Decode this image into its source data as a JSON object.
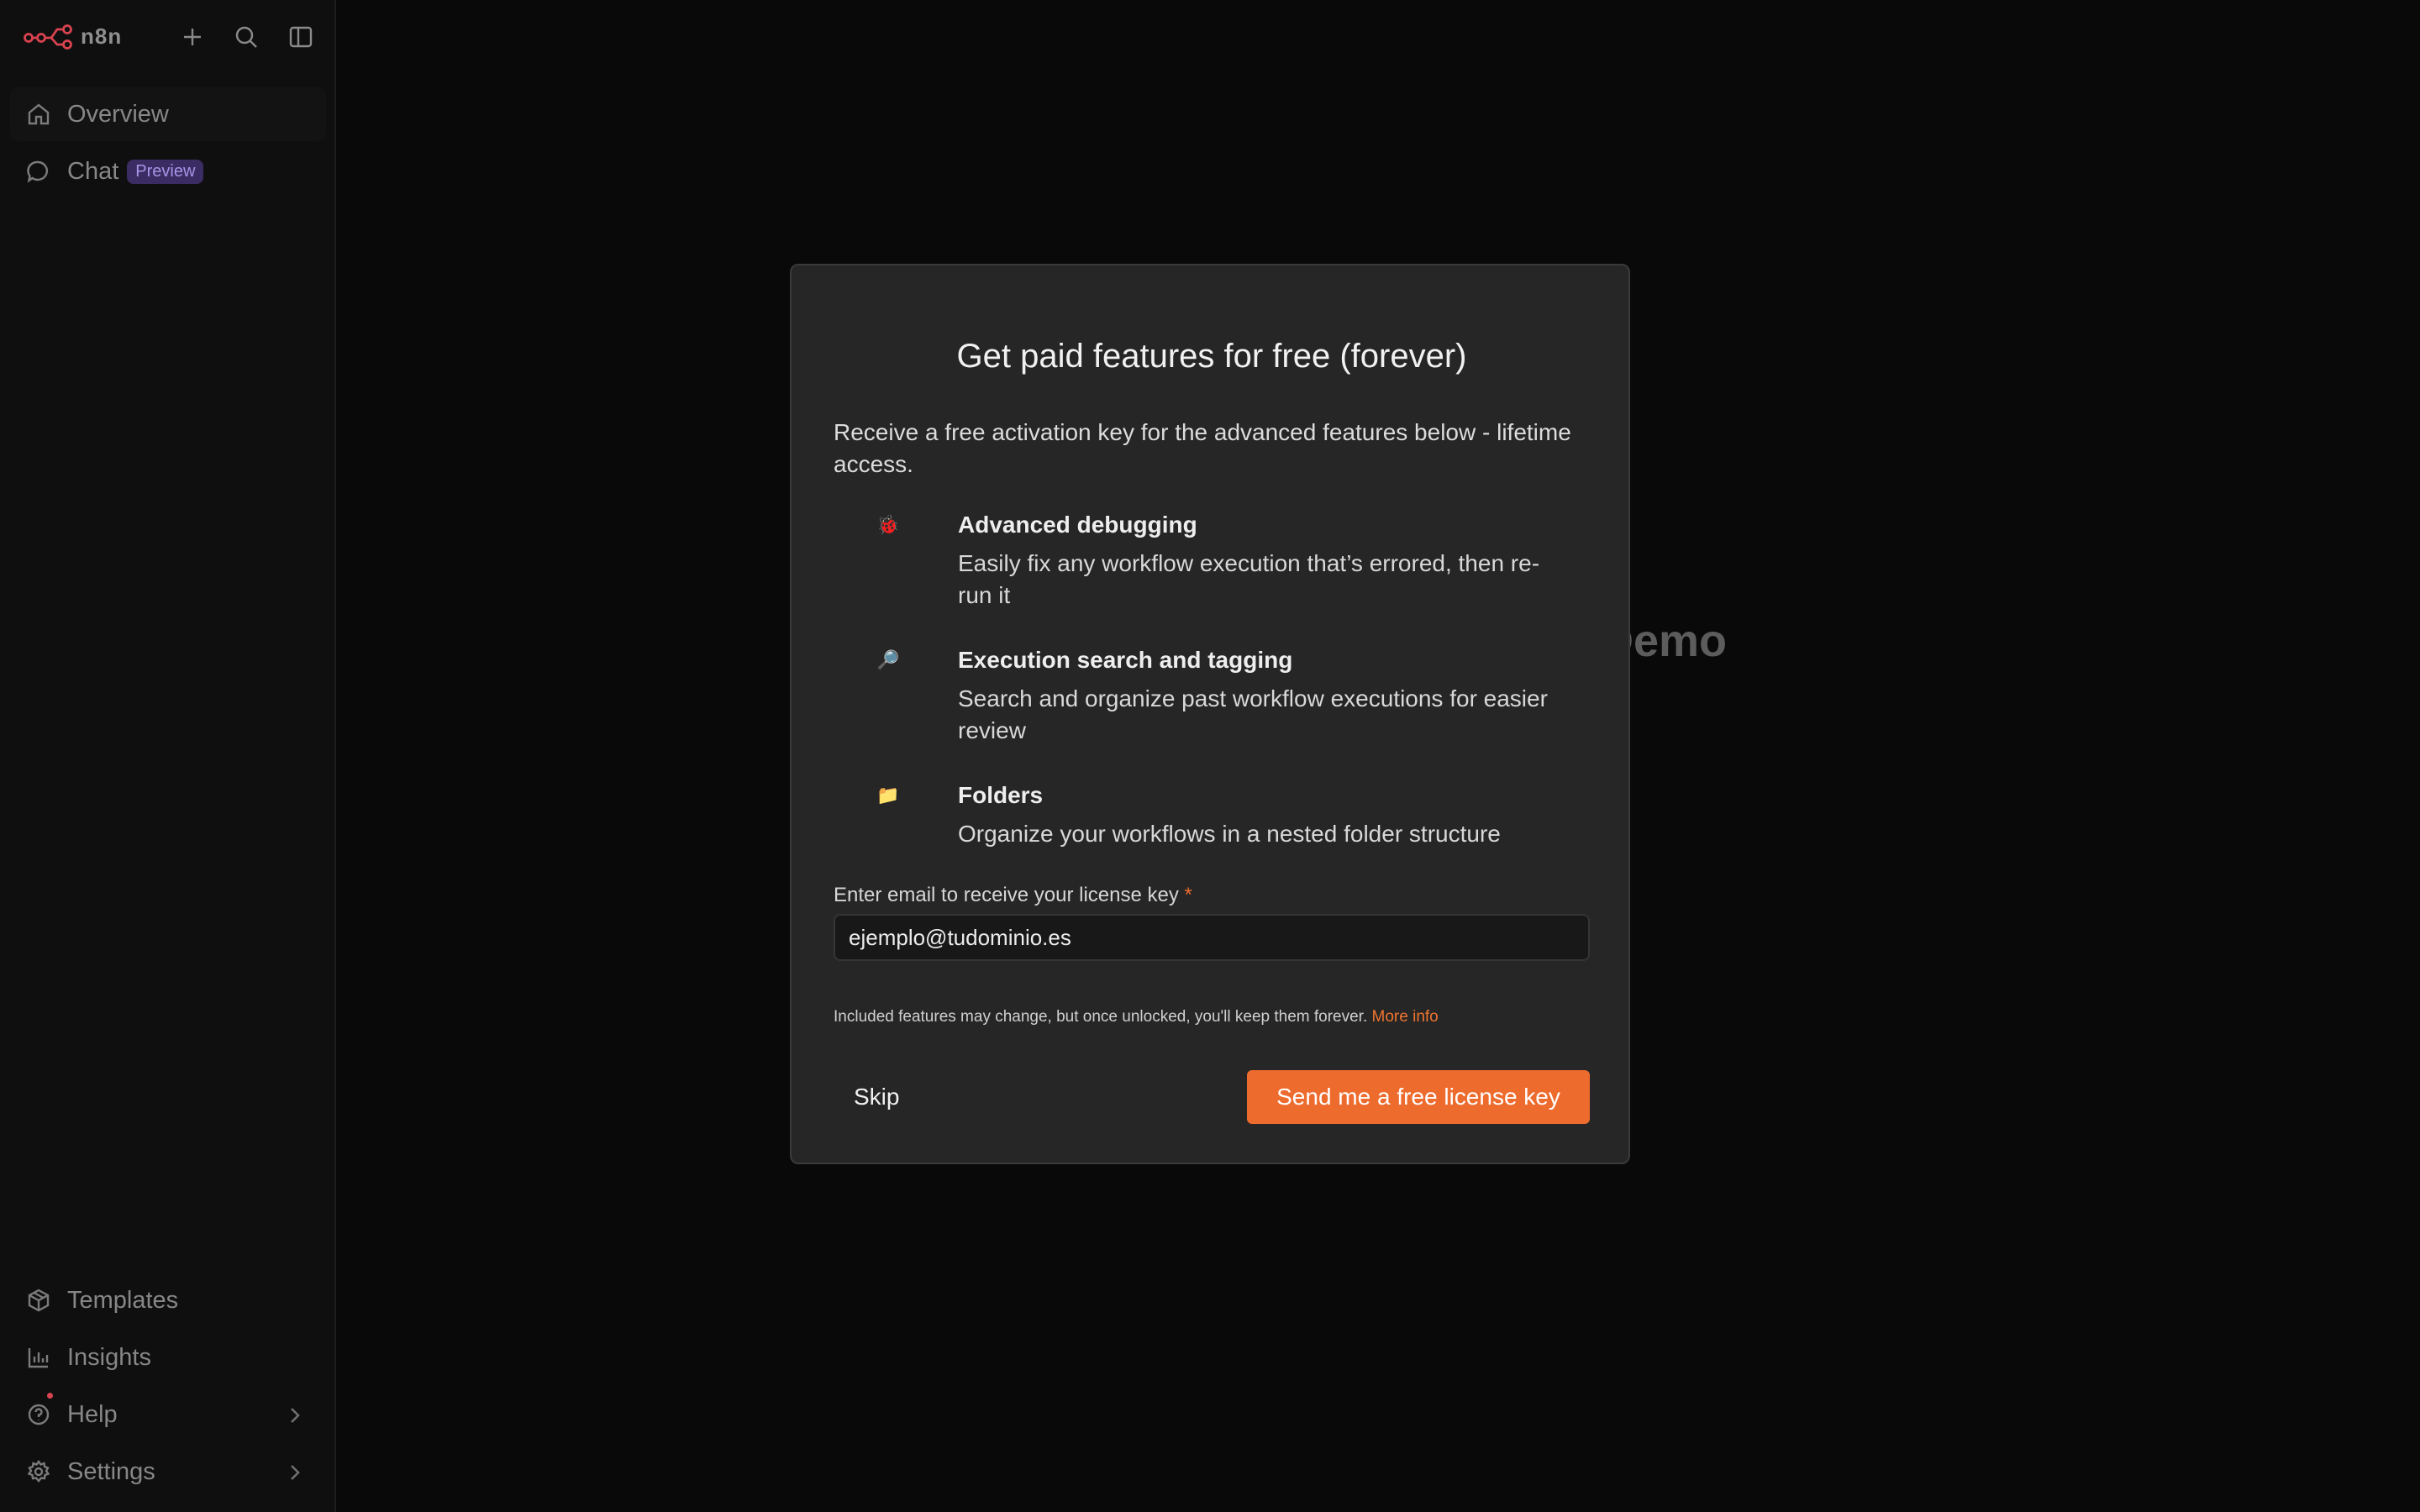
{
  "sidebar": {
    "logo_text": "n8n",
    "nav_top": [
      {
        "label": "Overview",
        "icon": "home-icon"
      },
      {
        "label": "Chat",
        "icon": "chat-icon",
        "badge": "Preview"
      }
    ],
    "nav_bottom": [
      {
        "label": "Templates",
        "icon": "templates-icon"
      },
      {
        "label": "Insights",
        "icon": "insights-icon"
      },
      {
        "label": "Help",
        "icon": "help-icon"
      },
      {
        "label": "Settings",
        "icon": "settings-icon"
      }
    ]
  },
  "main": {
    "background_heading_fragment": "Demo"
  },
  "modal": {
    "title": "Get paid features for free (forever)",
    "intro": "Receive a free activation key for the advanced features below - lifetime access.",
    "features": [
      {
        "icon": "ladybug-icon",
        "glyph": "🐞",
        "title": "Advanced debugging",
        "description": "Easily fix any workflow execution that’s errored, then re-run it"
      },
      {
        "icon": "magnifier-icon",
        "glyph": "🔎",
        "title": "Execution search and tagging",
        "description": "Search and organize past workflow executions for easier review"
      },
      {
        "icon": "folder-icon",
        "glyph": "📁",
        "title": "Folders",
        "description": "Organize your workflows in a nested folder structure"
      }
    ],
    "email_label": "Enter email to receive your license key",
    "required_marker": "*",
    "email_value": "ejemplo@tudominio.es",
    "footnote": "Included features may change, but once unlocked, you'll keep them forever.",
    "more_info_label": "More info",
    "skip_label": "Skip",
    "send_label": "Send me a free license key"
  },
  "colors": {
    "accent": "#ee6b2e",
    "background": "#090909",
    "modal_background": "#262626",
    "badge_background": "#3b2d63"
  }
}
